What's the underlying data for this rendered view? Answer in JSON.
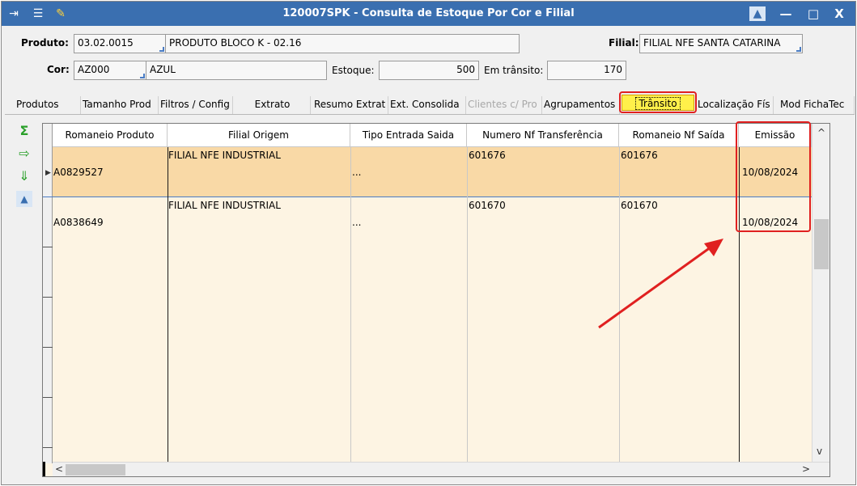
{
  "window": {
    "title": "120007SPK - Consulta de Estoque Por Cor e Filial",
    "controls": [
      "—",
      "□",
      "X"
    ]
  },
  "header": {
    "produto_label": "Produto:",
    "produto_code": "03.02.0015",
    "produto_desc": "PRODUTO BLOCO K - 02.16",
    "filial_label": "Filial:",
    "filial_value": "FILIAL NFE SANTA CATARINA",
    "cor_label": "Cor:",
    "cor_code": "AZ000",
    "cor_desc": "AZUL",
    "estoque_label": "Estoque:",
    "estoque_value": "500",
    "transito_label": "Em trânsito:",
    "transito_value": "170"
  },
  "tabs": [
    {
      "label": "Produtos"
    },
    {
      "label": "Tamanho Prod"
    },
    {
      "label": "Filtros / Config"
    },
    {
      "label": "Extrato"
    },
    {
      "label": "Resumo Extrat"
    },
    {
      "label": "Ext. Consolida"
    },
    {
      "label": "Clientes c/ Pro"
    },
    {
      "label": "Agrupamentos"
    },
    {
      "label": "Trânsito"
    },
    {
      "label": "Localização Fís"
    },
    {
      "label": "Mod FichaTec"
    }
  ],
  "grid": {
    "columns": [
      "Romaneio Produto",
      "Filial Origem",
      "Tipo Entrada Saida",
      "Numero Nf Transferência",
      "Romaneio Nf Saída",
      "Emissão"
    ],
    "rows": [
      {
        "romaneio": "A0829527",
        "filial": "FILIAL NFE INDUSTRIAL",
        "tipo": "...",
        "numero_nf": "601676",
        "romaneio_nf": "601676",
        "emissao": "10/08/2024"
      },
      {
        "romaneio": "A0838649",
        "filial": "FILIAL NFE INDUSTRIAL",
        "tipo": "...",
        "numero_nf": "601670",
        "romaneio_nf": "601670",
        "emissao": "10/08/2024"
      }
    ]
  },
  "colors": {
    "titlebar": "#3a6fb0",
    "selected_row": "#f9d9a6",
    "grid_bg": "#fdf4e3",
    "active_tab": "#fff04a",
    "highlight": "#e02020"
  },
  "icons": [
    "exit-icon",
    "traffic-light-icon",
    "wrench-icon",
    "image-icon",
    "sum-icon",
    "export-icon",
    "download-icon",
    "picture-icon"
  ]
}
